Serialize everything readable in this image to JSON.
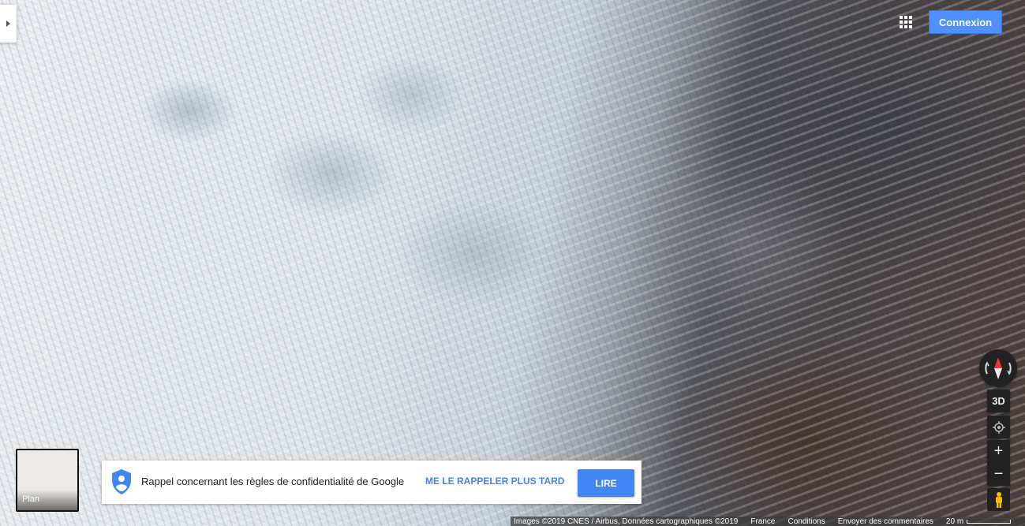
{
  "header": {
    "signin_label": "Connexion",
    "apps_icon": "apps-grid-icon"
  },
  "controls": {
    "tilt_label": "3D",
    "zoom_in_label": "+",
    "zoom_out_label": "−",
    "compass_icon": "compass-icon",
    "location_icon": "my-location-icon",
    "pegman_icon": "pegman-icon"
  },
  "layer_switcher": {
    "label": "Plan"
  },
  "privacy_banner": {
    "message": "Rappel concernant les règles de confidentialité de Google",
    "later_label": "ME LE RAPPELER PLUS TARD",
    "read_label": "LIRE",
    "icon": "shield-user-icon"
  },
  "footer": {
    "attribution": "Images ©2019 CNES / Airbus, Données cartographiques ©2019",
    "country": "France",
    "terms": "Conditions",
    "feedback": "Envoyer des commentaires",
    "scale_label": "20 m"
  },
  "colors": {
    "accent": "#4285f4",
    "signin": "#4d90fe",
    "control_bg": "#222222"
  }
}
